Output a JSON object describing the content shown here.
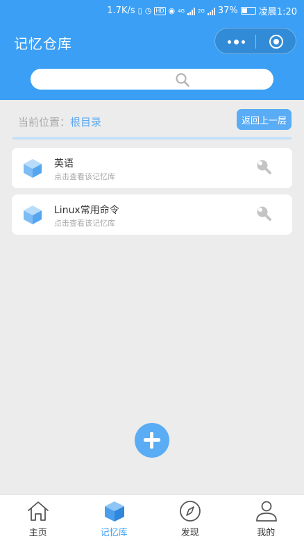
{
  "status_bar": {
    "speed": "1.7K/s",
    "hd_badge": "HD",
    "net1": "4G",
    "net2": "2G",
    "battery": "37%",
    "time": "凌晨1:20"
  },
  "header": {
    "title": "记忆仓库",
    "accent_color": "#3a9ff5"
  },
  "search": {
    "placeholder": "",
    "icon": "search-icon"
  },
  "location": {
    "prefix": "当前位置：",
    "current": "根目录",
    "back_label": "返回上一层"
  },
  "repos": [
    {
      "name": "英语",
      "subtitle": "点击查看该记忆库",
      "icon": "cube-icon",
      "action_icon": "wrench-icon"
    },
    {
      "name": "Linux常用命令",
      "subtitle": "点击查看该记忆库",
      "icon": "cube-icon",
      "action_icon": "wrench-icon"
    }
  ],
  "fab": {
    "icon": "plus-icon"
  },
  "tabbar": {
    "items": [
      {
        "label": "主页",
        "icon": "home-icon",
        "active": false
      },
      {
        "label": "记忆库",
        "icon": "cube-icon",
        "active": true
      },
      {
        "label": "发现",
        "icon": "compass-icon",
        "active": false
      },
      {
        "label": "我的",
        "icon": "user-icon",
        "active": false
      }
    ]
  }
}
